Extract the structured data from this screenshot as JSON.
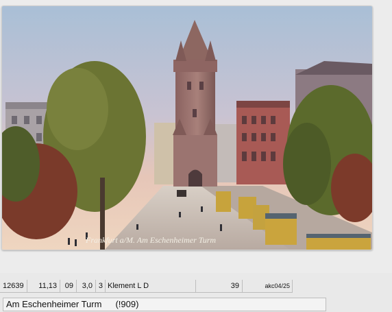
{
  "postcard": {
    "caption": "Frankfurt a/M. Am Eschenheimer Turm",
    "colors": {
      "sky": "#b9c9dc",
      "tower": "#9a7068",
      "foliage": "#5f6b2e",
      "street": "#c9bfb7"
    }
  },
  "listing": {
    "id": "12639",
    "col_a": "11,13",
    "col_b": "09",
    "col_c": "3,0",
    "col_d": "3",
    "seller": "Klement L D",
    "price": "39",
    "ref": "akc04/25"
  },
  "title": {
    "text": "Am Eschenheimer Turm",
    "year": "(!909)"
  }
}
